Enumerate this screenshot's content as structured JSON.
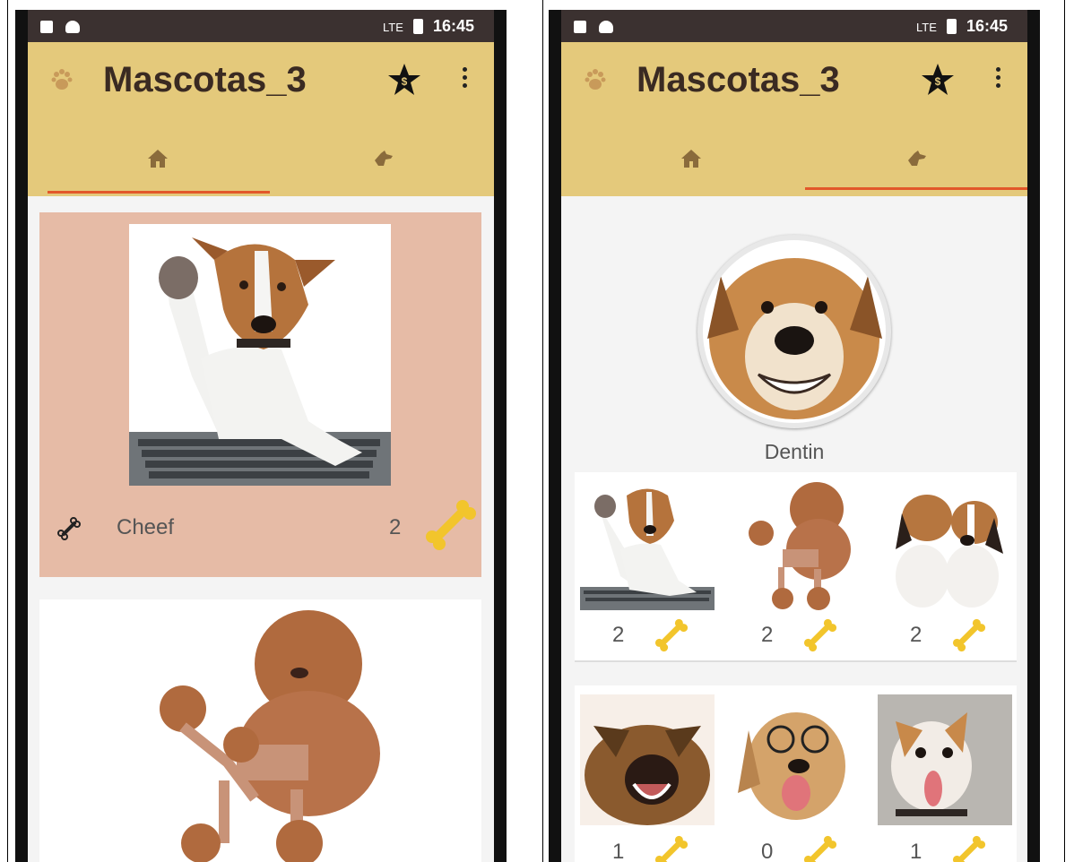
{
  "app": {
    "title": "Mascotas_3"
  },
  "status": {
    "time": "16:45",
    "signal": "LTE"
  },
  "colors": {
    "appbar": "#e4c97b",
    "accent": "#e2572a",
    "card_highlight": "#e6bba6",
    "status_bar": "#3b3130"
  },
  "icons": {
    "logo": "paw-icon",
    "action": "star-icon",
    "overflow": "more-vertical-icon",
    "tab_home": "home-icon",
    "tab_profile": "dog-icon",
    "like": "bone-outline-icon",
    "rating": "bone-icon"
  },
  "left_screen": {
    "selected_tab": "home",
    "cards": [
      {
        "name": "Cheef",
        "rating": "2",
        "photo": "jack-russell-keyboard-photo"
      },
      {
        "name": "",
        "rating": "",
        "photo": "poodle-photo"
      }
    ]
  },
  "right_screen": {
    "selected_tab": "profile",
    "profile": {
      "name": "Dentin",
      "photo": "smiling-dog-photo"
    },
    "grid": [
      {
        "rating": "2",
        "photo": "jack-russell-keyboard-photo"
      },
      {
        "rating": "2",
        "photo": "poodle-photo"
      },
      {
        "rating": "2",
        "photo": "beagle-puppies-photo"
      },
      {
        "rating": "1",
        "photo": "barking-shepherd-photo"
      },
      {
        "rating": "0",
        "photo": "dog-with-glasses-photo"
      },
      {
        "rating": "1",
        "photo": "chihuahua-tongue-photo"
      }
    ]
  }
}
